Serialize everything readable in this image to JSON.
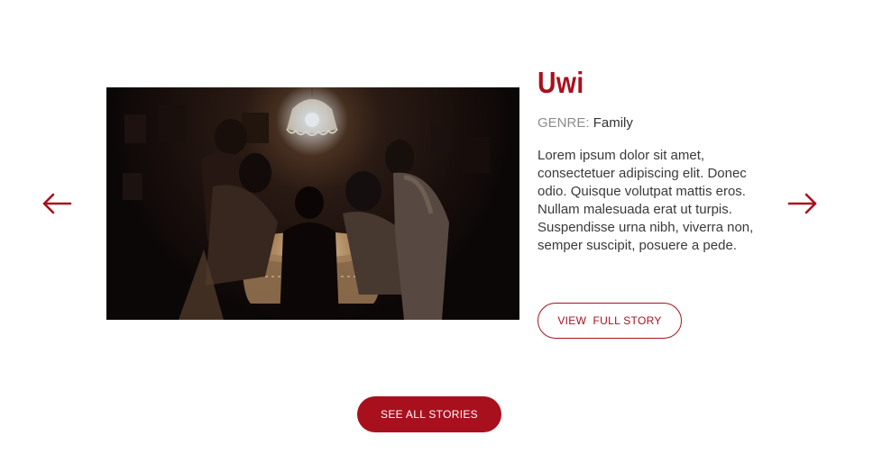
{
  "carousel": {
    "prev_icon": "arrow-left-icon",
    "next_icon": "arrow-right-icon",
    "accent_color": "#a8101e"
  },
  "story": {
    "image_alt": "family-around-table-photo",
    "title": "Uwi",
    "genre_label": "GENRE:",
    "genre_value": "Family",
    "description": "Lorem ipsum dolor sit amet, consectetuer adipiscing elit. Donec odio. Quisque volutpat mattis eros. Nullam malesuada erat ut turpis. Suspendisse urna nibh, viverra non, semper suscipit, posuere a pede.",
    "view_button_label": "VIEW  FULL STORY"
  },
  "footer": {
    "see_all_label": "SEE ALL STORIES"
  }
}
